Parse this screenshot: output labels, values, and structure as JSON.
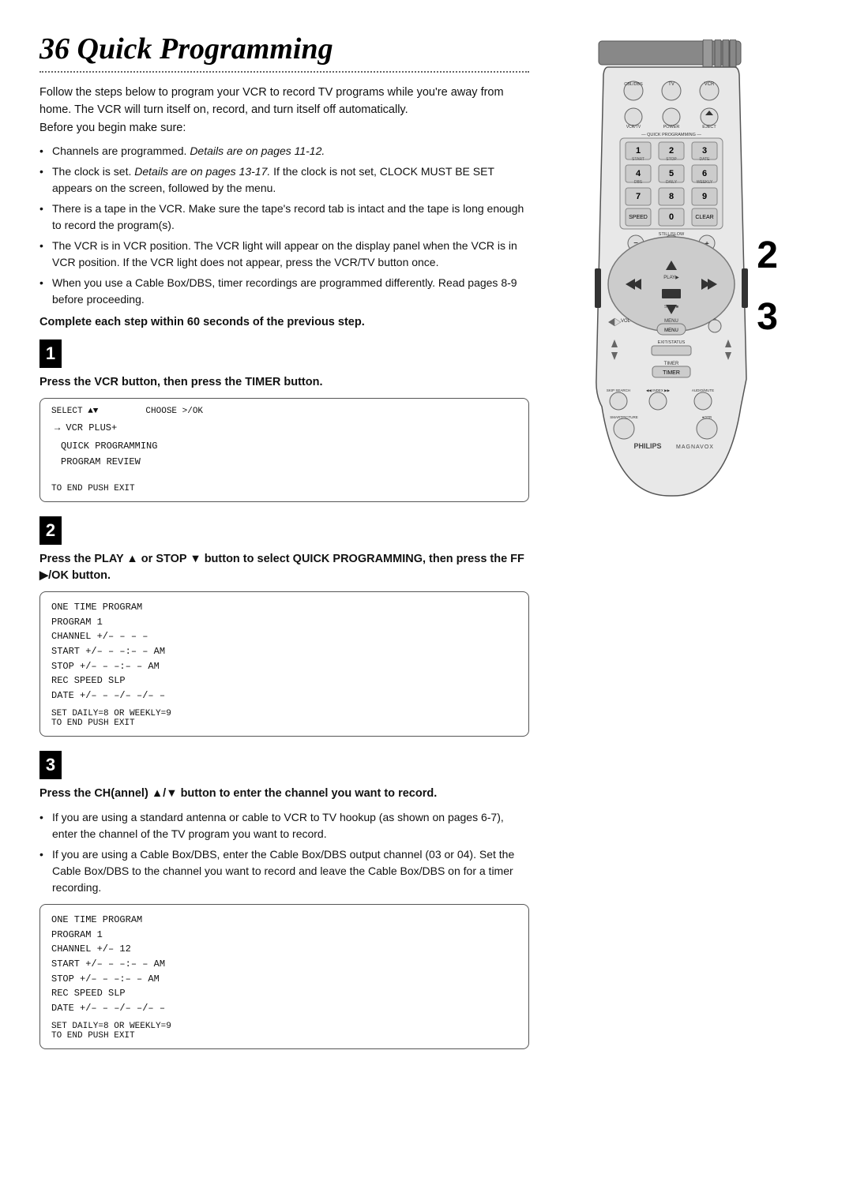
{
  "page": {
    "title": "36 Quick Programming",
    "dots": true
  },
  "intro": {
    "paragraph1": "Follow the steps below to program your VCR to record TV programs while you're away from home. The VCR will turn itself on, record, and turn itself off automatically.",
    "paragraph2": "Before you begin make sure:",
    "bullets": [
      "Channels are programmed. Details are on pages 11-12.",
      "The clock is set. Details are on pages 13-17. If the clock is not set, CLOCK MUST BE SET appears on the screen, followed by the menu.",
      "There is a tape in the VCR. Make sure the tape's record tab is intact and the tape is long enough to record the program(s).",
      "The VCR is in VCR position. The VCR light will appear on the display panel when the VCR is in VCR position. If the VCR light does not appear, press the VCR/TV button once.",
      "When you use a Cable Box/DBS, timer recordings are programmed differently. Read pages 8-9 before proceeding."
    ],
    "bold_line": "Complete each step within 60 seconds of the previous step."
  },
  "step1": {
    "number": "1",
    "instruction": "Press the VCR button, then press the TIMER button.",
    "screen": {
      "top_left": "SELECT ▲▼",
      "top_right": "CHOOSE >/OK",
      "arrow_item": "→ VCR PLUS+",
      "menu_items": [
        "QUICK PROGRAMMING",
        "PROGRAM REVIEW"
      ],
      "bottom": "TO END PUSH EXIT"
    }
  },
  "step2": {
    "number": "2",
    "instruction": "Press the PLAY ▲ or STOP ▼ button to select QUICK PROGRAMMING, then press the FF ▶/OK button.",
    "screen": {
      "top_label": "ONE TIME PROGRAM",
      "lines": [
        "PROGRAM       1",
        "CHANNEL +/–  – – –",
        "START +/–    – –:– –  AM",
        "STOP +/–     – –:– –  AM",
        "REC SPEED    SLP",
        "DATE +/–     – –/– –/– –"
      ],
      "bottom_lines": [
        "SET DAILY=8 OR WEEKLY=9",
        "TO END PUSH EXIT"
      ]
    }
  },
  "step3": {
    "number": "3",
    "instruction": "Press the CH(annel) ▲/▼ button to enter the channel you want to record.",
    "bullets": [
      "If you are using a standard antenna or cable to VCR to TV hookup (as shown on pages 6-7), enter the channel of the TV program you want to record.",
      "If you are using a Cable Box/DBS, enter the Cable Box/DBS output channel (03 or 04). Set the Cable Box/DBS to the channel you want to record and leave the Cable Box/DBS on for a timer recording."
    ],
    "screen2": {
      "top_label": "ONE TIME PROGRAM",
      "lines": [
        "PROGRAM       1",
        "CHANNEL +/–  12",
        "START +/–    – –:– –  AM",
        "STOP +/–     – –:– –  AM",
        "REC SPEED    SLP",
        "DATE +/–     – –/– –/– –"
      ],
      "bottom_lines": [
        "SET DAILY=8 OR WEEKLY=9",
        "TO END PUSH EXIT"
      ]
    }
  },
  "remote": {
    "brand": "PHILIPS",
    "sub_brand": "MAGNAVOX",
    "labels": {
      "cbl_dbs": "CBL/DBS",
      "tv": "TV",
      "vcr": "VCR",
      "vcr_tv": "VCR/TV",
      "power": "POWER",
      "eject": "EJECT",
      "quick_programming": "QUICK PROGRAMMING",
      "start": "START",
      "stop_label": "STOP",
      "date": "DATE",
      "dbs": "DBS",
      "daily": "DAILY",
      "weekly": "WEEKLY",
      "speed": "SPEED",
      "clear": "CLEAR",
      "still_slow": "STILL/SLOW",
      "rew": "REW",
      "ff": "FF",
      "play": "PLAY",
      "vol": "VOL",
      "menu": "MENU",
      "exit_status": "EXIT/STATUS",
      "timer": "TIMER",
      "skip_search": "SKIP SEARCH",
      "index": "INDEX",
      "audio_mute": "AUDIO/MUTE",
      "smartpicture": "SMARTPICTURE",
      "otr": "OTR"
    }
  }
}
